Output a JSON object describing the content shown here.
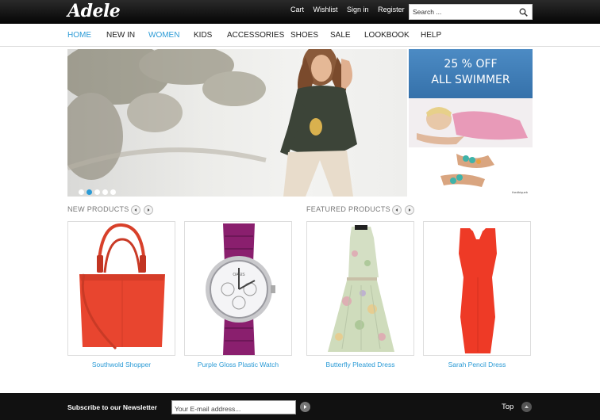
{
  "brand": {
    "logo": "Adele"
  },
  "top_links": [
    {
      "label": "Cart"
    },
    {
      "label": "Wishlist"
    },
    {
      "label": "Sign in"
    },
    {
      "label": "Register"
    }
  ],
  "search": {
    "placeholder": "Search ...",
    "icon": "search-icon"
  },
  "nav": [
    {
      "label": "HOME",
      "active": true
    },
    {
      "label": "NEW IN",
      "active": false
    },
    {
      "label": "WOMEN",
      "active": true
    },
    {
      "label": "KIDS",
      "active": false
    },
    {
      "label": "ACCESSORIES",
      "active": false
    },
    {
      "label": "SHOES",
      "active": false
    },
    {
      "label": "SALE",
      "active": false
    },
    {
      "label": "LOOKBOOK",
      "active": false
    },
    {
      "label": "HELP",
      "active": false
    }
  ],
  "slider": {
    "slide_count": 5,
    "active_slide": 2
  },
  "promo": {
    "line1": "25 % OFF",
    "line2": "ALL SWIMMER",
    "credit": "thedbiqueb"
  },
  "sections": {
    "new_products": "NEW PRODUCTS",
    "featured_products": "FEATURED PRODUCTS"
  },
  "products": [
    {
      "name": "Southwold Shopper",
      "color": "#e8452f"
    },
    {
      "name": "Purple Gloss Plastic Watch",
      "color": "#8a1f6e",
      "brand_text": "OASIS"
    },
    {
      "name": "Butterfly Pleated Dress",
      "color": "#c9d9b9"
    },
    {
      "name": "Sarah Pencil Dress",
      "color": "#ee3a26"
    }
  ],
  "footer": {
    "newsletter_label": "Subscribe to our Newsletter",
    "email_placeholder": "Your E-mail address...",
    "top_label": "Top"
  },
  "colors": {
    "accent": "#2b9bd6",
    "topbar": "#0a0a0a",
    "footer": "#111111"
  }
}
